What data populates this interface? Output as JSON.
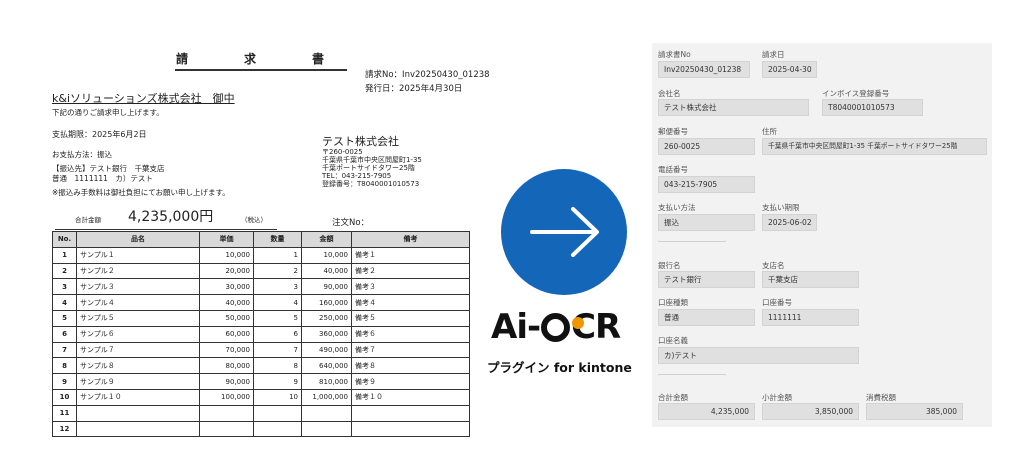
{
  "invoice": {
    "title": "請　求　書",
    "number": "請求No：Inv20250430_01238",
    "issue_date": "発行日：2025年4月30日",
    "client": "k&iソリューションズ株式会社　御中",
    "subtitle": "下記の通りご請求申し上げます。",
    "due": "支払期限：2025年6月2日",
    "method": "お支払方法：振込",
    "bank_line1": "【振込先】テスト銀行　千葉支店",
    "bank_line2": "普通　1111111　カ）テスト",
    "fee_note": "※振込み手数料は御社負担にてお願い申し上げます。",
    "issuer": {
      "name": "テスト株式会社",
      "postal": "〒260-0025",
      "address1": "千葉県千葉市中央区問屋町1-35",
      "address2": "千葉ポートサイドタワー25階",
      "tel": "TEL：043-215-7905",
      "registration": "登録番号：T8040001010573"
    },
    "total_label": "合計金額",
    "total_amount": "4,235,000円",
    "total_tax": "（税込）",
    "order_no_label": "注文No：",
    "columns": [
      "No.",
      "品名",
      "単価",
      "数量",
      "金額",
      "備考"
    ],
    "rows": [
      [
        "1",
        "サンプル１",
        "10,000",
        "1",
        "10,000",
        "備考１"
      ],
      [
        "2",
        "サンプル２",
        "20,000",
        "2",
        "40,000",
        "備考２"
      ],
      [
        "3",
        "サンプル３",
        "30,000",
        "3",
        "90,000",
        "備考３"
      ],
      [
        "4",
        "サンプル４",
        "40,000",
        "4",
        "160,000",
        "備考４"
      ],
      [
        "5",
        "サンプル５",
        "50,000",
        "5",
        "250,000",
        "備考５"
      ],
      [
        "6",
        "サンプル６",
        "60,000",
        "6",
        "360,000",
        "備考６"
      ],
      [
        "7",
        "サンプル７",
        "70,000",
        "7",
        "490,000",
        "備考７"
      ],
      [
        "8",
        "サンプル８",
        "80,000",
        "8",
        "640,000",
        "備考８"
      ],
      [
        "9",
        "サンプル９",
        "90,000",
        "9",
        "810,000",
        "備考９"
      ],
      [
        "10",
        "サンプル１０",
        "100,000",
        "10",
        "1,000,000",
        "備考１０"
      ],
      [
        "11",
        "",
        "",
        "",
        "",
        ""
      ],
      [
        "12",
        "",
        "",
        "",
        "",
        ""
      ]
    ]
  },
  "brand": {
    "arrow_color": "#1466b8",
    "logo_text_prefix": "Ai-",
    "logo_text_suffix": "CR",
    "logo_accent": "#f29600",
    "tagline": "プラグイン for kintone"
  },
  "form": {
    "invoice_no": {
      "label": "請求書No",
      "value": "Inv20250430_01238"
    },
    "invoice_date": {
      "label": "請求日",
      "value": "2025-04-30"
    },
    "company": {
      "label": "会社名",
      "value": "テスト株式会社"
    },
    "invoice_reg": {
      "label": "インボイス登録番号",
      "value": "T8040001010573"
    },
    "postal": {
      "label": "郵便番号",
      "value": "260-0025"
    },
    "address": {
      "label": "住所",
      "value": "千葉県千葉市中央区問屋町1-35 千葉ポートサイドタワー25階"
    },
    "phone": {
      "label": "電話番号",
      "value": "043-215-7905"
    },
    "pay_method": {
      "label": "支払い方法",
      "value": "振込"
    },
    "pay_due": {
      "label": "支払い期限",
      "value": "2025-06-02"
    },
    "bank": {
      "label": "銀行名",
      "value": "テスト銀行"
    },
    "branch": {
      "label": "支店名",
      "value": "千葉支店"
    },
    "acct_type": {
      "label": "口座種類",
      "value": "普通"
    },
    "acct_no": {
      "label": "口座番号",
      "value": "1111111"
    },
    "acct_name": {
      "label": "口座名義",
      "value": "カ)テスト"
    },
    "total": {
      "label": "合計金額",
      "value": "4,235,000"
    },
    "subtotal": {
      "label": "小計金額",
      "value": "3,850,000"
    },
    "tax": {
      "label": "消費税額",
      "value": "385,000"
    }
  }
}
